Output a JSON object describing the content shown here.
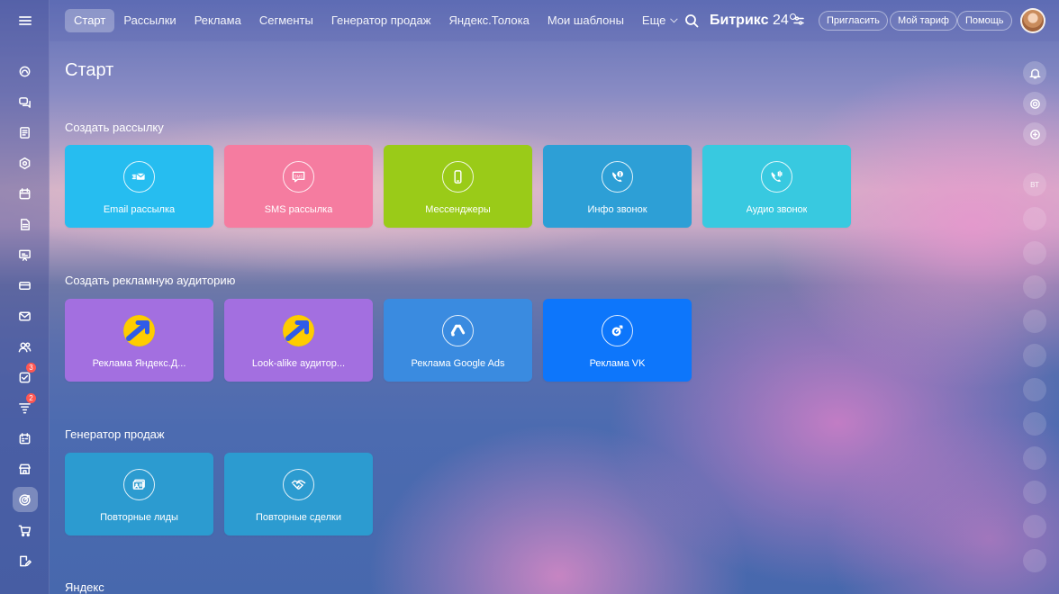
{
  "colors": {
    "tile_blue": "#26bdf0",
    "tile_pink": "#f57ca0",
    "tile_green": "#9acb18",
    "tile_steel": "#2d9fd6",
    "tile_teal": "#38c9e0",
    "tile_violet": "#a36fe0",
    "tile_google": "#3a8be0",
    "tile_vk": "#0d76fb",
    "tile_sales": "#2c9bd0",
    "badge_red": "#ff5752"
  },
  "sidebar": {
    "menu_icon": "hamburger-menu-icon",
    "items": [
      {
        "icon": "feed-icon",
        "badge": ""
      },
      {
        "icon": "chat-icon",
        "badge": ""
      },
      {
        "icon": "document-icon",
        "badge": ""
      },
      {
        "icon": "hexagon-icon",
        "badge": ""
      },
      {
        "icon": "calendar-icon",
        "badge": ""
      },
      {
        "icon": "file-icon",
        "badge": ""
      },
      {
        "icon": "presentation-icon",
        "badge": ""
      },
      {
        "icon": "card-icon",
        "badge": ""
      },
      {
        "icon": "mail-icon",
        "badge": ""
      },
      {
        "icon": "users-icon",
        "badge": ""
      },
      {
        "icon": "tasks-icon",
        "badge": "3"
      },
      {
        "icon": "funnel-icon",
        "badge": "2"
      },
      {
        "icon": "schedule-icon",
        "badge": ""
      },
      {
        "icon": "store-icon",
        "badge": ""
      },
      {
        "icon": "target-icon",
        "badge": "",
        "active": true
      },
      {
        "icon": "cart-icon",
        "badge": ""
      },
      {
        "icon": "edit-icon",
        "badge": ""
      }
    ]
  },
  "topbar": {
    "tabs": [
      {
        "label": "Старт",
        "active": true
      },
      {
        "label": "Рассылки"
      },
      {
        "label": "Реклама"
      },
      {
        "label": "Сегменты"
      },
      {
        "label": "Генератор продаж"
      },
      {
        "label": "Яндекс.Толока"
      },
      {
        "label": "Мои шаблоны"
      },
      {
        "label": "Еще"
      }
    ],
    "logo_name": "Битрикс",
    "logo_num": "24",
    "invite_label": "Пригласить",
    "tariff_label": "Мой тариф",
    "help_label": "Помощь"
  },
  "rail": {
    "user_initials": "ВТ"
  },
  "main": {
    "title": "Старт",
    "sections": [
      {
        "title": "Создать рассылку",
        "tiles": [
          {
            "label": "Email рассылка",
            "icon": "email-send-icon",
            "color": "#26bdf0"
          },
          {
            "label": "SMS рассылка",
            "icon": "sms-icon",
            "color": "#f57ca0"
          },
          {
            "label": "Мессенджеры",
            "icon": "phone-icon",
            "color": "#9acb18"
          },
          {
            "label": "Инфо звонок",
            "icon": "info-call-icon",
            "color": "#2d9fd6"
          },
          {
            "label": "Аудио звонок",
            "icon": "audio-call-icon",
            "color": "#38c9e0"
          }
        ]
      },
      {
        "title": "Создать рекламную аудиторию",
        "tiles": [
          {
            "label": "Реклама Яндекс.Д...",
            "icon": "yandex-direct-icon",
            "color": "#a36fe0"
          },
          {
            "label": "Look-alike аудитор...",
            "icon": "yandex-direct-icon",
            "color": "#a36fe0"
          },
          {
            "label": "Реклама Google Ads",
            "icon": "google-ads-icon",
            "color": "#3a8be0"
          },
          {
            "label": "Реклама VK",
            "icon": "vk-ads-icon",
            "color": "#0d76fb"
          }
        ]
      },
      {
        "title": "Генератор продаж",
        "tiles": [
          {
            "label": "Повторные лиды",
            "icon": "repeat-leads-icon",
            "color": "#2c9bd0"
          },
          {
            "label": "Повторные сделки",
            "icon": "handshake-icon",
            "color": "#2c9bd0"
          }
        ]
      },
      {
        "title": "Яндекс",
        "tiles": []
      }
    ]
  },
  "sms_icon_text": "SMS"
}
